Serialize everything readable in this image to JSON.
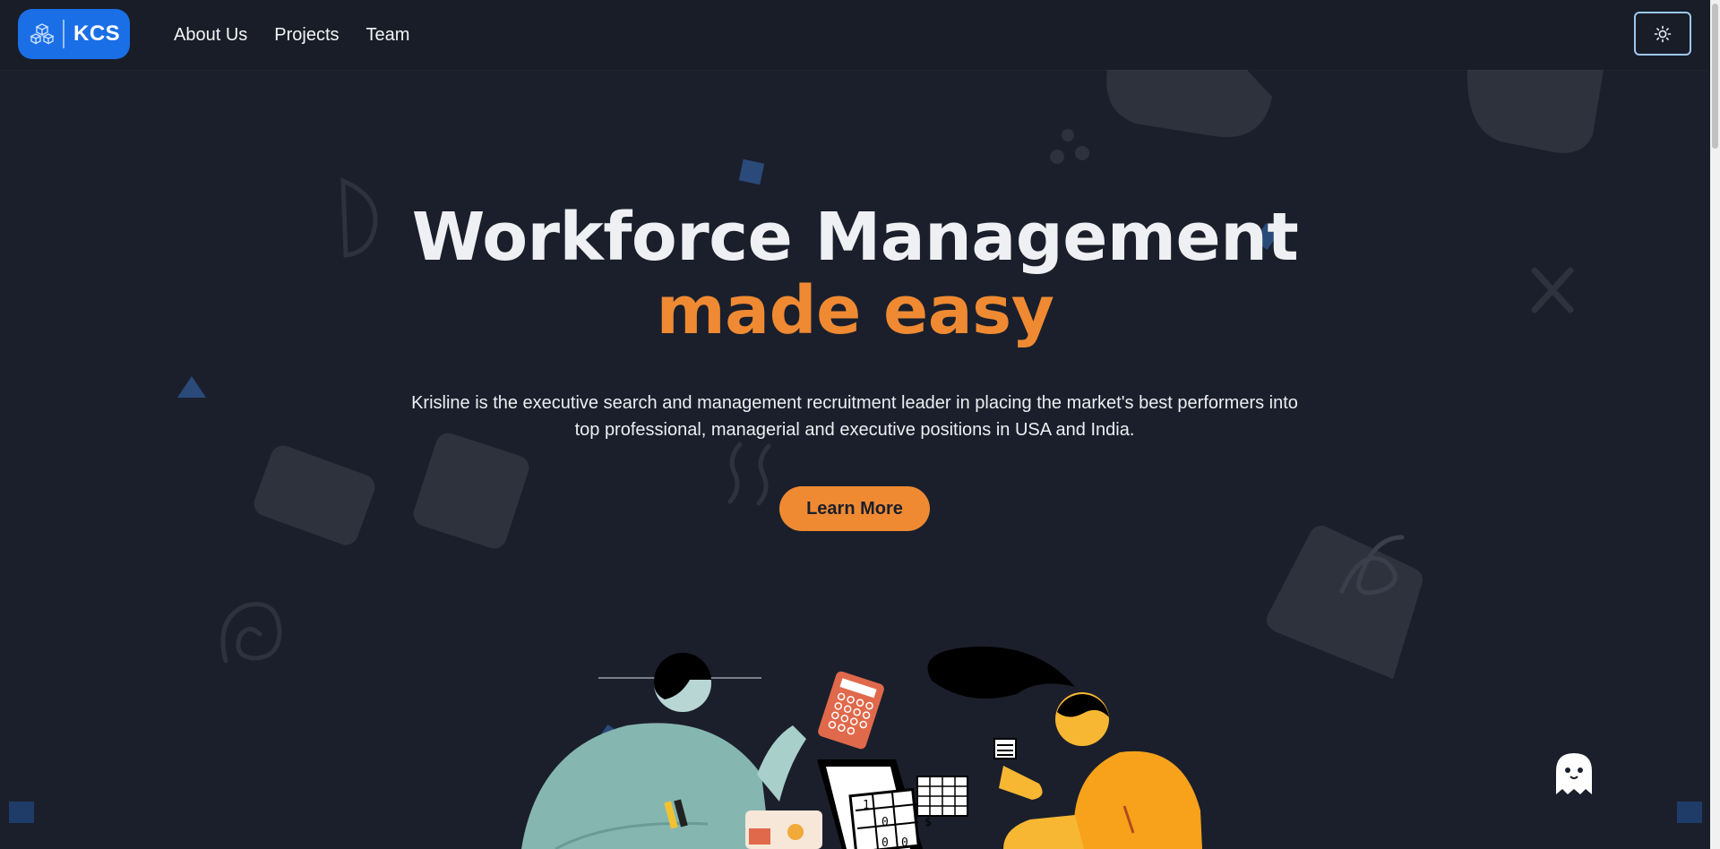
{
  "brand": {
    "logo_text": "KCS"
  },
  "nav": {
    "items": [
      {
        "label": "About Us"
      },
      {
        "label": "Projects"
      },
      {
        "label": "Team"
      }
    ],
    "theme_toggle_icon": "sun-icon"
  },
  "hero": {
    "title_line1": "Workforce Management",
    "title_line2": "made easy",
    "description": "Krisline is the executive search and management recruitment leader in placing the market's best performers into top professional, managerial and executive positions in USA and India.",
    "cta_label": "Learn More"
  },
  "colors": {
    "background": "#1b1f2b",
    "header": "#191d27",
    "accent_orange": "#ef8a33",
    "brand_blue": "#1a6fe6",
    "text": "#eef0f3"
  },
  "floating_icon": "ghost-icon"
}
